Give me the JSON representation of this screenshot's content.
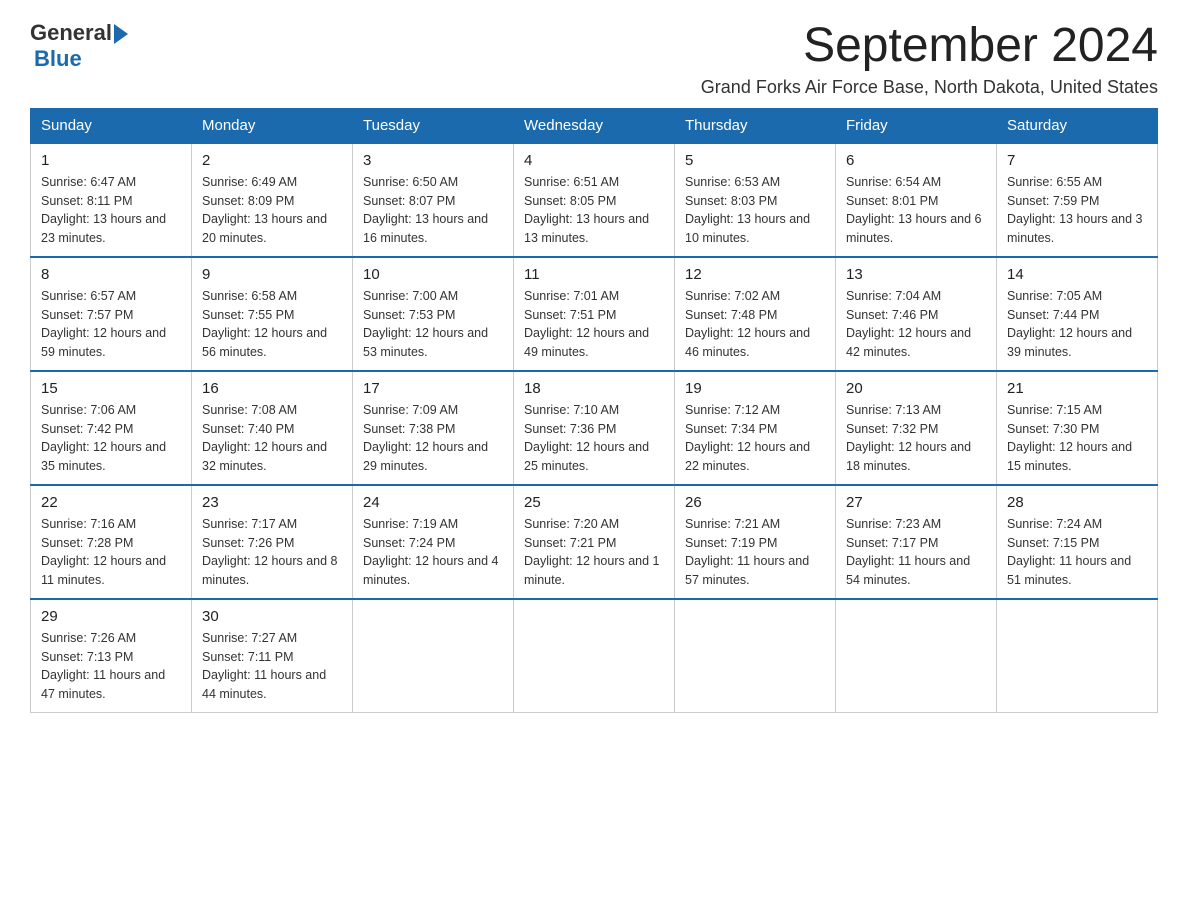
{
  "logo": {
    "text_general": "General",
    "text_blue": "Blue"
  },
  "title": "September 2024",
  "subtitle": "Grand Forks Air Force Base, North Dakota, United States",
  "days_of_week": [
    "Sunday",
    "Monday",
    "Tuesday",
    "Wednesday",
    "Thursday",
    "Friday",
    "Saturday"
  ],
  "weeks": [
    [
      {
        "date": "1",
        "sunrise": "6:47 AM",
        "sunset": "8:11 PM",
        "daylight": "13 hours and 23 minutes."
      },
      {
        "date": "2",
        "sunrise": "6:49 AM",
        "sunset": "8:09 PM",
        "daylight": "13 hours and 20 minutes."
      },
      {
        "date": "3",
        "sunrise": "6:50 AM",
        "sunset": "8:07 PM",
        "daylight": "13 hours and 16 minutes."
      },
      {
        "date": "4",
        "sunrise": "6:51 AM",
        "sunset": "8:05 PM",
        "daylight": "13 hours and 13 minutes."
      },
      {
        "date": "5",
        "sunrise": "6:53 AM",
        "sunset": "8:03 PM",
        "daylight": "13 hours and 10 minutes."
      },
      {
        "date": "6",
        "sunrise": "6:54 AM",
        "sunset": "8:01 PM",
        "daylight": "13 hours and 6 minutes."
      },
      {
        "date": "7",
        "sunrise": "6:55 AM",
        "sunset": "7:59 PM",
        "daylight": "13 hours and 3 minutes."
      }
    ],
    [
      {
        "date": "8",
        "sunrise": "6:57 AM",
        "sunset": "7:57 PM",
        "daylight": "12 hours and 59 minutes."
      },
      {
        "date": "9",
        "sunrise": "6:58 AM",
        "sunset": "7:55 PM",
        "daylight": "12 hours and 56 minutes."
      },
      {
        "date": "10",
        "sunrise": "7:00 AM",
        "sunset": "7:53 PM",
        "daylight": "12 hours and 53 minutes."
      },
      {
        "date": "11",
        "sunrise": "7:01 AM",
        "sunset": "7:51 PM",
        "daylight": "12 hours and 49 minutes."
      },
      {
        "date": "12",
        "sunrise": "7:02 AM",
        "sunset": "7:48 PM",
        "daylight": "12 hours and 46 minutes."
      },
      {
        "date": "13",
        "sunrise": "7:04 AM",
        "sunset": "7:46 PM",
        "daylight": "12 hours and 42 minutes."
      },
      {
        "date": "14",
        "sunrise": "7:05 AM",
        "sunset": "7:44 PM",
        "daylight": "12 hours and 39 minutes."
      }
    ],
    [
      {
        "date": "15",
        "sunrise": "7:06 AM",
        "sunset": "7:42 PM",
        "daylight": "12 hours and 35 minutes."
      },
      {
        "date": "16",
        "sunrise": "7:08 AM",
        "sunset": "7:40 PM",
        "daylight": "12 hours and 32 minutes."
      },
      {
        "date": "17",
        "sunrise": "7:09 AM",
        "sunset": "7:38 PM",
        "daylight": "12 hours and 29 minutes."
      },
      {
        "date": "18",
        "sunrise": "7:10 AM",
        "sunset": "7:36 PM",
        "daylight": "12 hours and 25 minutes."
      },
      {
        "date": "19",
        "sunrise": "7:12 AM",
        "sunset": "7:34 PM",
        "daylight": "12 hours and 22 minutes."
      },
      {
        "date": "20",
        "sunrise": "7:13 AM",
        "sunset": "7:32 PM",
        "daylight": "12 hours and 18 minutes."
      },
      {
        "date": "21",
        "sunrise": "7:15 AM",
        "sunset": "7:30 PM",
        "daylight": "12 hours and 15 minutes."
      }
    ],
    [
      {
        "date": "22",
        "sunrise": "7:16 AM",
        "sunset": "7:28 PM",
        "daylight": "12 hours and 11 minutes."
      },
      {
        "date": "23",
        "sunrise": "7:17 AM",
        "sunset": "7:26 PM",
        "daylight": "12 hours and 8 minutes."
      },
      {
        "date": "24",
        "sunrise": "7:19 AM",
        "sunset": "7:24 PM",
        "daylight": "12 hours and 4 minutes."
      },
      {
        "date": "25",
        "sunrise": "7:20 AM",
        "sunset": "7:21 PM",
        "daylight": "12 hours and 1 minute."
      },
      {
        "date": "26",
        "sunrise": "7:21 AM",
        "sunset": "7:19 PM",
        "daylight": "11 hours and 57 minutes."
      },
      {
        "date": "27",
        "sunrise": "7:23 AM",
        "sunset": "7:17 PM",
        "daylight": "11 hours and 54 minutes."
      },
      {
        "date": "28",
        "sunrise": "7:24 AM",
        "sunset": "7:15 PM",
        "daylight": "11 hours and 51 minutes."
      }
    ],
    [
      {
        "date": "29",
        "sunrise": "7:26 AM",
        "sunset": "7:13 PM",
        "daylight": "11 hours and 47 minutes."
      },
      {
        "date": "30",
        "sunrise": "7:27 AM",
        "sunset": "7:11 PM",
        "daylight": "11 hours and 44 minutes."
      },
      null,
      null,
      null,
      null,
      null
    ]
  ]
}
